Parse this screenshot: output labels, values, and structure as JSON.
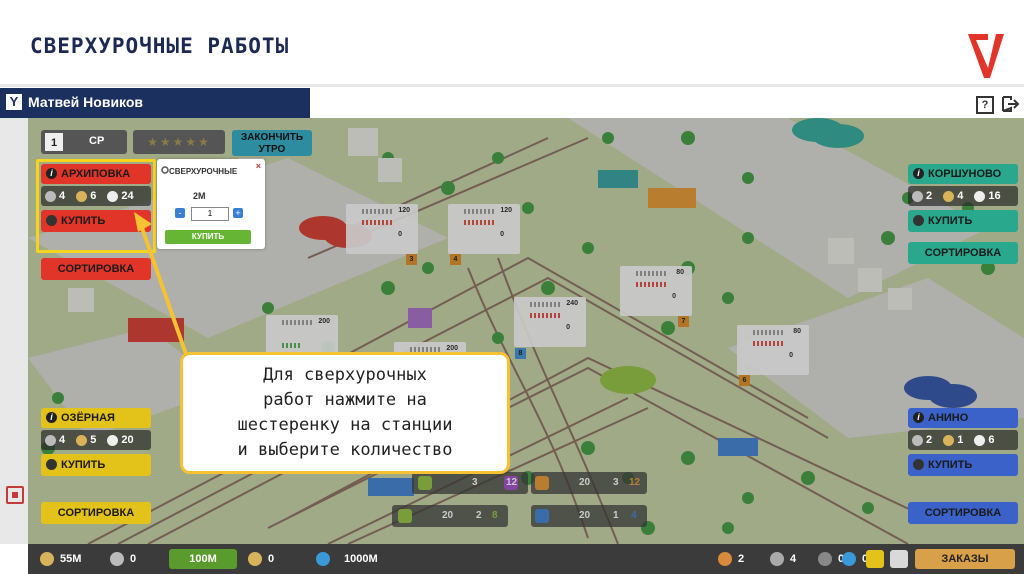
{
  "slide": {
    "title": "СВЕРХУРОЧНЫЕ РАБОТЫ"
  },
  "appbar": {
    "logo": "Y",
    "user": "Матвей Новиков",
    "help": "?"
  },
  "hud": {
    "day": "1",
    "weekday": "СР",
    "stars": "★★★★★",
    "finish_label": "ЗАКОНЧИТЬ УТРО"
  },
  "stations": [
    {
      "name": "АРХИПОВКА",
      "v1": "4",
      "v2": "6",
      "v3": "24",
      "buy": "КУПИТЬ",
      "sort": "СОРТИРОВКА",
      "color": "#e2352a"
    },
    {
      "name": "КОРШУНОВО",
      "v1": "2",
      "v2": "4",
      "v3": "16",
      "buy": "КУПИТЬ",
      "sort": "СОРТИРОВКА",
      "color": "#2aa88e"
    },
    {
      "name": "ОЗЁРНАЯ",
      "v1": "4",
      "v2": "5",
      "v3": "20",
      "buy": "КУПИТЬ",
      "sort": "СОРТИРОВКА",
      "color": "#e3c21a"
    },
    {
      "name": "АНИНО",
      "v1": "2",
      "v2": "1",
      "v3": "6",
      "buy": "КУПИТЬ",
      "sort": "СОРТИРОВКА",
      "color": "#3a62c8"
    }
  ],
  "overtime": {
    "title": "СВЕРХУРОЧНЫЕ",
    "amount": "2M",
    "qty": "1",
    "minus": "-",
    "plus": "+",
    "buy": "КУПИТЬ",
    "close": "×"
  },
  "callout": {
    "lines": [
      "Для сверхурочных",
      "работ нажмите на",
      "шестеренку на станции",
      "и выберите количество"
    ]
  },
  "map_panels": [
    {
      "cap": "120",
      "rs": "0"
    },
    {
      "cap": "120",
      "rs": "0"
    },
    {
      "cap": "80",
      "rs": "0"
    },
    {
      "cap": "240",
      "rs": "0"
    },
    {
      "cap": "200",
      "rs": ""
    },
    {
      "cap": "80",
      "rs": "0"
    },
    {
      "cap": "200",
      "rs": ""
    }
  ],
  "map_tags": [
    "3",
    "4",
    "7",
    "8",
    "6"
  ],
  "routes": [
    {
      "a": "3",
      "b": "12"
    },
    {
      "a": "20",
      "b": "3",
      "c": "12"
    },
    {
      "a": "20",
      "b": "2",
      "c": "8"
    },
    {
      "a": "20",
      "b": "1",
      "c": "4"
    }
  ],
  "bottom": {
    "money1": "55M",
    "count1": "0",
    "money_btn": "100M",
    "count2": "0",
    "money3": "1000M",
    "r1": "2",
    "r2": "4",
    "r3": "0",
    "r4": "0",
    "orders": "ЗАКАЗЫ"
  },
  "colors": {
    "accent": "#1c3060",
    "brand_red": "#e2352a",
    "highlight": "#f6d31c"
  }
}
